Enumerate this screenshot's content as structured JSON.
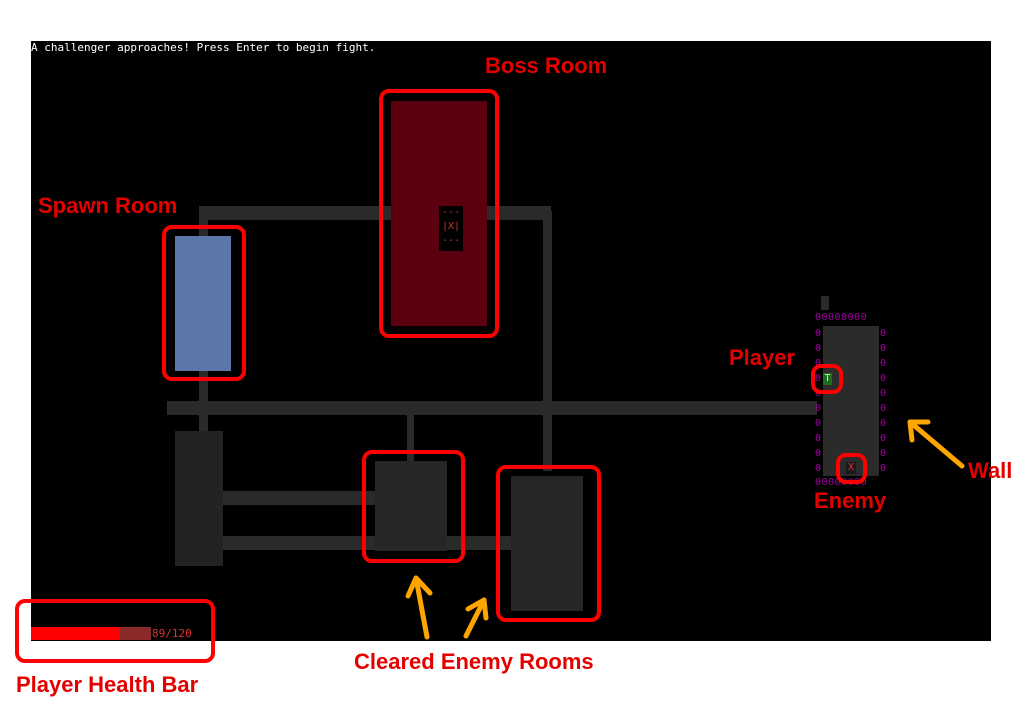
{
  "status_message": "A challenger approaches! Press Enter to begin fight.",
  "boss_marker": "---\n|X|\n---",
  "player_glyph": "T",
  "enemy_glyph": "X",
  "wall_glyph_row": "00000000",
  "wall_glyph_col": "0\n0\n0\n0\n0\n0\n0\n0\n0\n0",
  "health": {
    "current": 89,
    "max": 120,
    "text": "89/120"
  },
  "annotations": {
    "boss_room": "Boss Room",
    "spawn_room": "Spawn Room",
    "player": "Player",
    "wall": "Wall",
    "enemy": "Enemy",
    "cleared_rooms": "Cleared Enemy Rooms",
    "health_bar": "Player Health Bar"
  },
  "colors": {
    "annotation_red": "#ff0000",
    "arrow_orange": "#ffa500",
    "spawn_room": "#5b76a8",
    "boss_room": "#5c000f",
    "wall_purple": "#a000a0",
    "hp_fill": "#ff0000"
  }
}
